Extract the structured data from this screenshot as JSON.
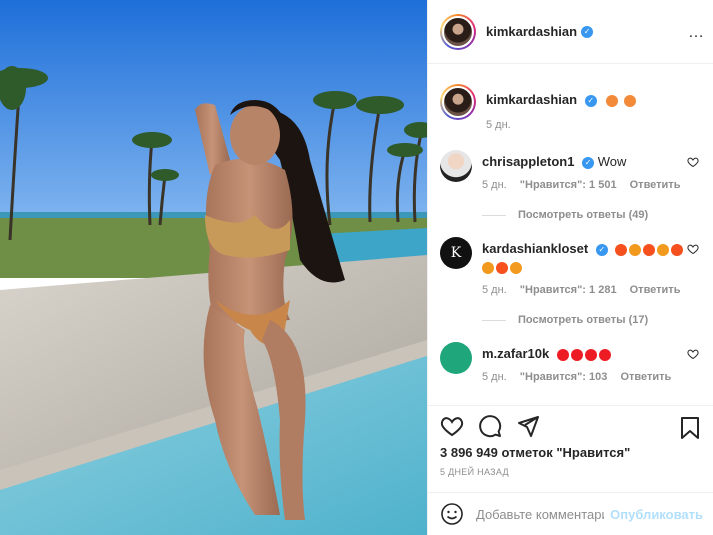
{
  "header": {
    "username": "kimkardashian",
    "more_label": "…"
  },
  "caption": {
    "username": "kimkardashian",
    "emojis": [
      "peach-emoji",
      "peach-emoji"
    ],
    "time": "5 дн."
  },
  "comments": [
    {
      "username": "chrisappleton1",
      "verified": true,
      "text": "Wow",
      "time": "5 дн.",
      "likes": "\"Нравится\": 1 501",
      "reply": "Ответить",
      "view_replies": "Посмотреть ответы (49)"
    },
    {
      "username": "kardashiankloset",
      "verified": true,
      "emojis_line1": [
        "fire",
        "heart-orange",
        "fire",
        "heart-orange",
        "fire"
      ],
      "emojis_line2": [
        "heart-orange",
        "fire",
        "heart-orange"
      ],
      "time": "5 дн.",
      "likes": "\"Нравится\": 1 281",
      "reply": "Ответить",
      "view_replies": "Посмотреть ответы (17)"
    },
    {
      "username": "m.zafar10k",
      "verified": false,
      "emojis_line1": [
        "heart-red",
        "heart-red",
        "heart-red",
        "heart-red"
      ],
      "time": "5 дн.",
      "likes": "\"Нравится\": 103",
      "reply": "Ответить"
    }
  ],
  "likes_total": "3 896 949 отметок \"Нравится\"",
  "posted_ago": "5 ДНЕЙ НАЗАД",
  "add_comment": {
    "placeholder": "Добавьте комментарий...",
    "publish": "Опубликовать"
  },
  "colors": {
    "accent": "#3897f0",
    "publish_disabled": "#b2dffc",
    "muted": "#8e8e8e",
    "red_heart": "#ed4956"
  }
}
